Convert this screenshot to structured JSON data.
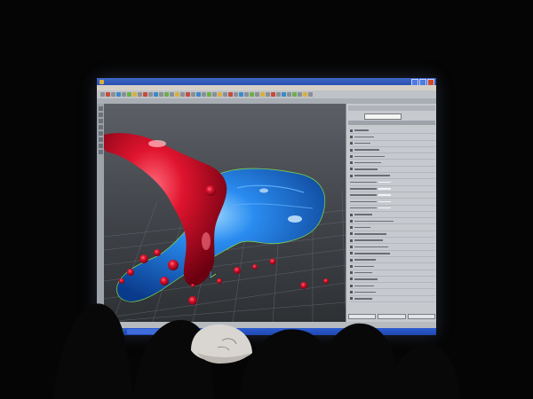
{
  "scene": {
    "description_type": "photo-of-projected-screen",
    "colors": {
      "background": "#050505",
      "fluid_red": "#c8102a",
      "fluid_blue": "#1a6ad8",
      "viewport_grid": "#7a7f86",
      "highlight_green": "#7fdc4a"
    },
    "icons": [
      "maya-window",
      "fluid-simulation-viewport",
      "attribute-editor-panel",
      "audience-silhouettes",
      "baseball-cap"
    ]
  }
}
